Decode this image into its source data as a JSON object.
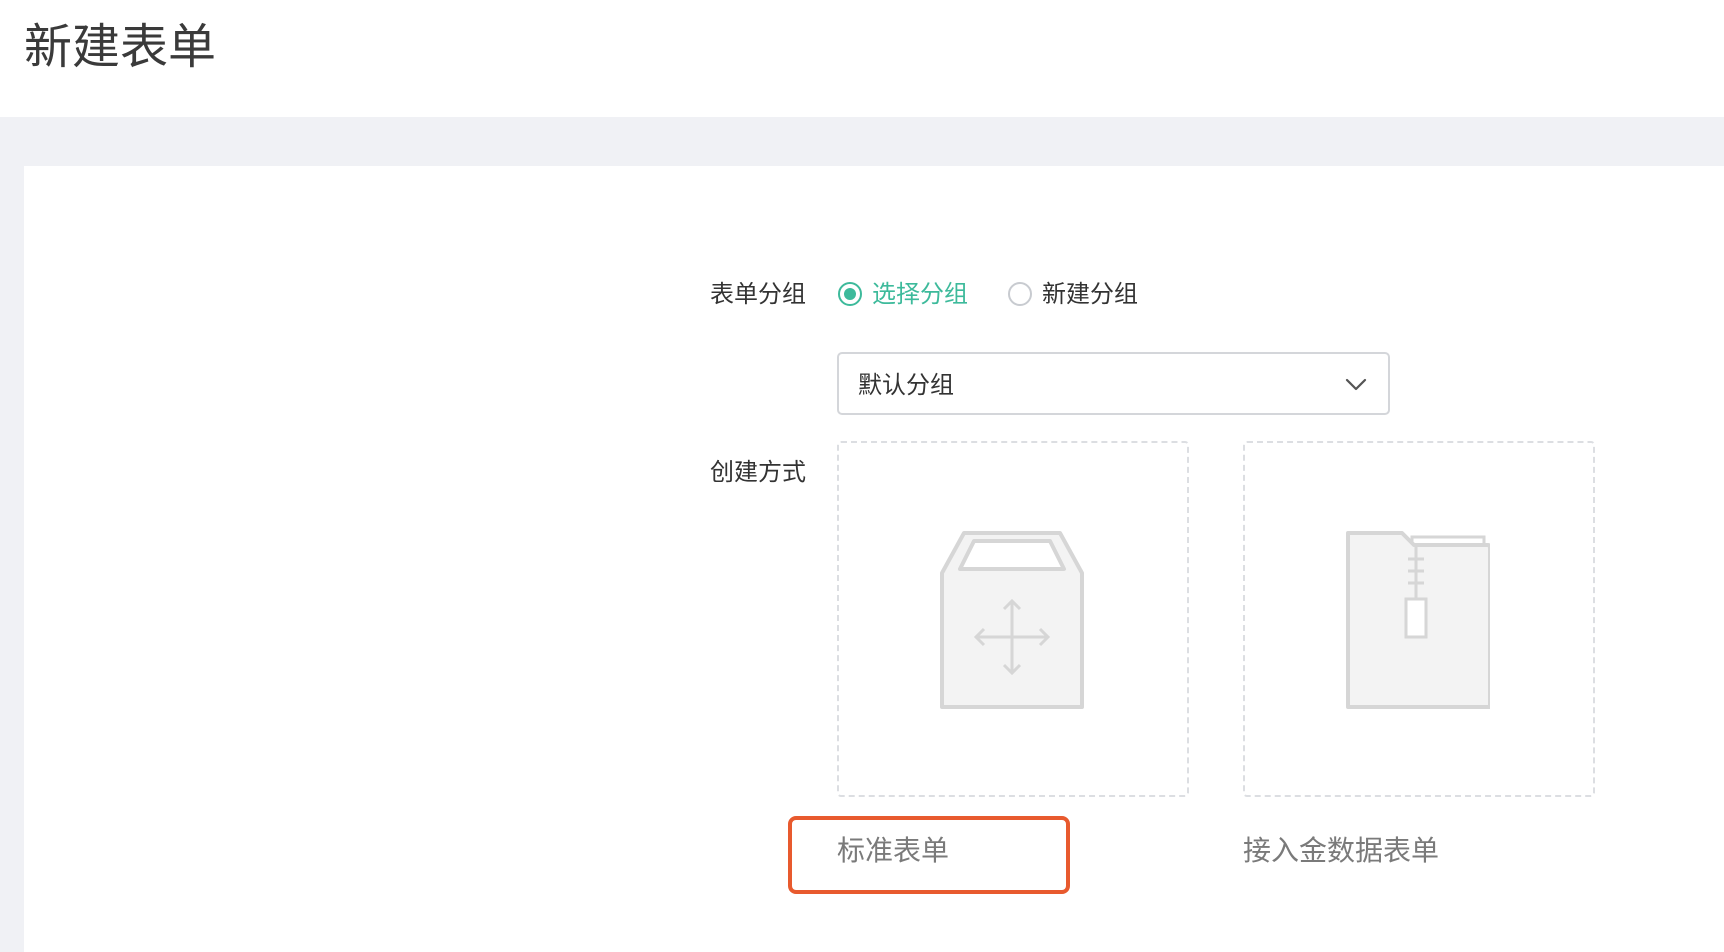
{
  "header": {
    "title": "新建表单"
  },
  "form": {
    "group_label": "表单分组",
    "group_options": [
      {
        "label": "选择分组",
        "checked": true
      },
      {
        "label": "新建分组",
        "checked": false
      }
    ],
    "group_select": {
      "value": "默认分组"
    },
    "method_label": "创建方式",
    "methods": [
      {
        "label": "标准表单",
        "icon": "box-move-icon",
        "highlighted": true
      },
      {
        "label": "接入金数据表单",
        "icon": "zip-file-icon",
        "highlighted": false
      }
    ]
  },
  "colors": {
    "accent": "#3dba9b",
    "highlight": "#e85a2e",
    "page_bg": "#f0f1f5",
    "icon_gray": "#d6d6d6"
  }
}
